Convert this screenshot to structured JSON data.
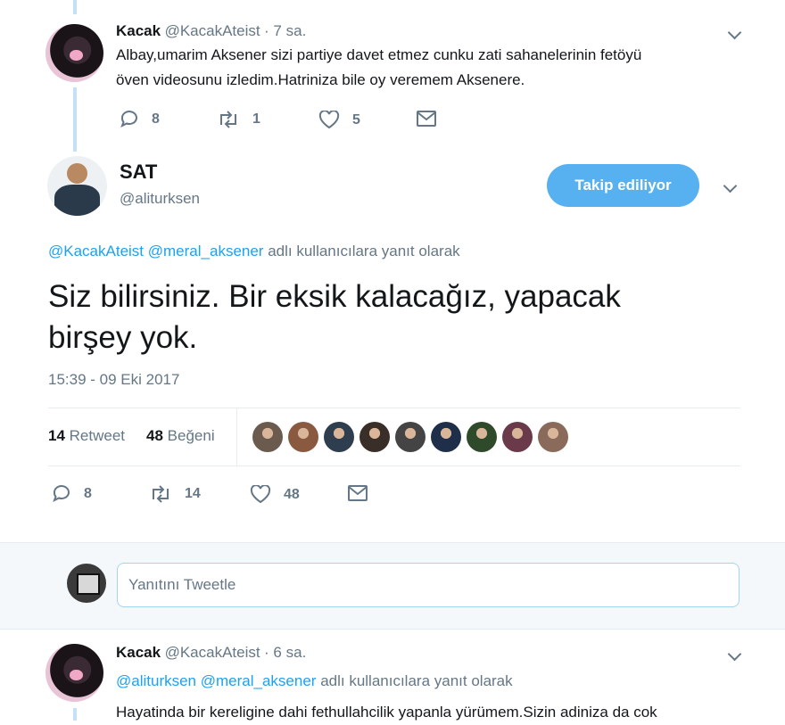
{
  "reply1": {
    "name": "Kacak",
    "handle": "@KacakAteist",
    "time": "· 7 sa.",
    "text_line1": "Albay,umarim Aksener sizi partiye davet etmez cunku zati sahanelerinin fetöyü",
    "text_line2": "öven videosunu izledim.Hatriniza bile oy veremem Aksenere.",
    "replies": "8",
    "retweets": "1",
    "likes": "5"
  },
  "main_tweet": {
    "name": "SAT",
    "handle": "@aliturksen",
    "follow_button": "Takip ediliyor",
    "reply_to_user1": "@KacakAteist",
    "reply_to_user2": "@meral_aksener",
    "reply_to_suffix": "adlı kullanıcılara yanıt olarak",
    "text_line1": "Siz bilirsiniz. Bir eksik kalacağız, yapacak",
    "text_line2": "birşey yok.",
    "timestamp": "15:39 - 09 Eki 2017",
    "retweet_count": "14",
    "retweet_label": "Retweet",
    "like_count": "48",
    "like_label": "Beğeni",
    "replies": "8",
    "retweets": "14",
    "likes": "48"
  },
  "likers": [
    "#6b5a4e",
    "#8a5a40",
    "#2e3e4e",
    "#3a2e28",
    "#444444",
    "#1f2f4a",
    "#2f4a2a",
    "#6a3a4a",
    "#8a6a5a"
  ],
  "reply_box": {
    "placeholder": "Yanıtını Tweetle"
  },
  "reply2": {
    "name": "Kacak",
    "handle": "@KacakAteist",
    "time": "· 6 sa.",
    "reply_to_user1": "@aliturksen",
    "reply_to_user2": "@meral_aksener",
    "reply_to_suffix": "adlı kullanıcılara yanıt olarak",
    "text_line1": "Hayatinda bir kereligine dahi fethullahcilik yapanla yürümem.Sizin adiniza da cok"
  },
  "colors": {
    "accent": "#1da1f2",
    "muted": "#657786",
    "follow_button": "#57b0ef",
    "thread_line": "#c4e1f7"
  }
}
